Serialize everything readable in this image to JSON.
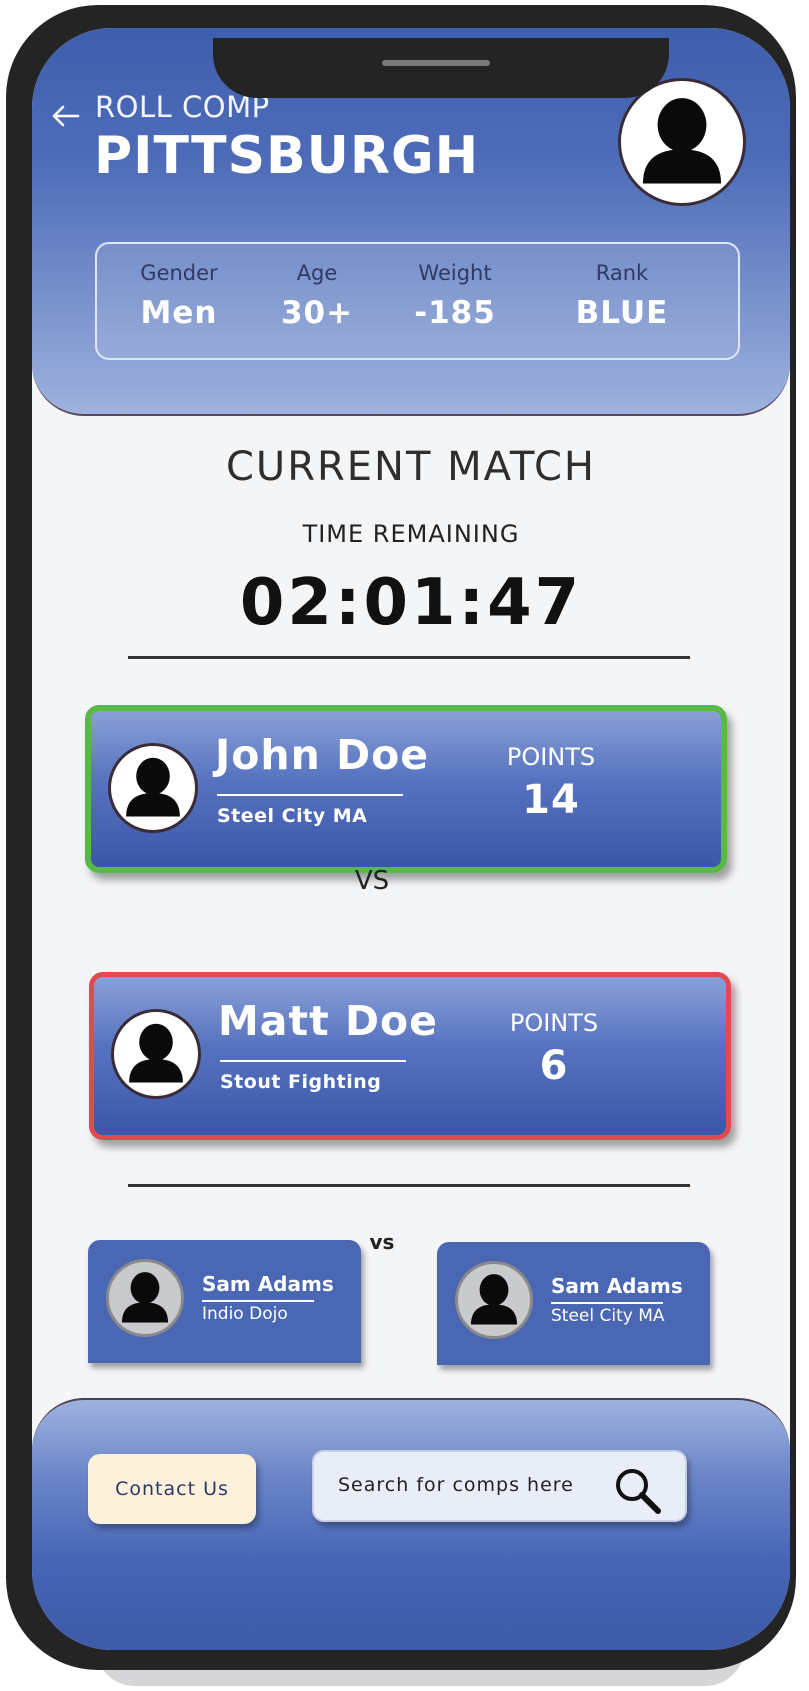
{
  "header": {
    "brand": "ROLL COMP",
    "city": "PITTSBURGH",
    "filters": [
      {
        "label": "Gender",
        "value": "Men"
      },
      {
        "label": "Age",
        "value": "30+"
      },
      {
        "label": "Weight",
        "value": "-185"
      },
      {
        "label": "Rank",
        "value": "BLUE"
      }
    ]
  },
  "match": {
    "title": "CURRENT MATCH",
    "time_label": "TIME REMAINING",
    "time_remaining": "02:01:47",
    "vs": "VS",
    "fighters": [
      {
        "name": "John Doe",
        "team": "Steel City MA",
        "points_label": "POINTS",
        "points": "14",
        "status_color": "#58b947"
      },
      {
        "name": "Matt Doe",
        "team": "Stout Fighting",
        "points_label": "POINTS",
        "points": "6",
        "status_color": "#e24a4f"
      }
    ]
  },
  "upcoming": {
    "vs": "vs",
    "fighters": [
      {
        "name": "Sam Adams",
        "team": "Indio Dojo"
      },
      {
        "name": "Sam Adams",
        "team": "Steel City MA"
      }
    ]
  },
  "footer": {
    "contact_label": "Contact Us",
    "search_placeholder": "Search for comps here"
  },
  "icons": {
    "back": "arrow-left-icon",
    "avatar": "user-silhouette-icon",
    "search": "magnifier-icon"
  },
  "colors": {
    "primary_blue": "#4a67b4",
    "winner_border": "#58b947",
    "loser_border": "#e24a4f",
    "contact_button": "#fdf1dc"
  }
}
